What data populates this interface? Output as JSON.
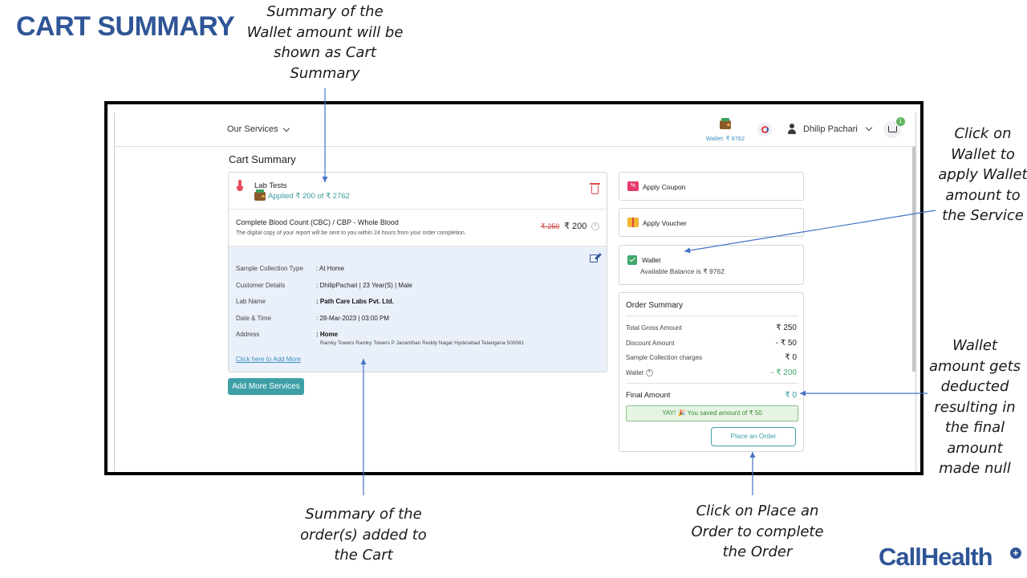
{
  "slide": {
    "title": "CART SUMMARY",
    "brand": "CallHealth",
    "brand_mark": "+"
  },
  "callouts": {
    "wallet_summary": "Summary of the\nWallet amount will be\nshown as Cart\nSummary",
    "click_wallet": "Click on\nWallet to\napply Wallet\namount to\nthe Service",
    "wallet_deducted": "Wallet\namount gets\ndeducted\nresulting in\nthe final\namount\nmade null",
    "order_summary": "Summary of the\norder(s) added to\nthe Cart",
    "place_order": "Click on Place an\nOrder to complete\nthe Order"
  },
  "nav": {
    "services": "Our Services",
    "wallet_label": "Wallet: ₹ 9762",
    "user_name": "Dhilip Pachari",
    "cart_count": "1"
  },
  "page": {
    "heading": "Cart Summary"
  },
  "lab": {
    "title": "Lab Tests",
    "applied": "Applied ₹ 200 of ₹ 2762",
    "test_name": "Complete Blood Count (CBC) /  CBP - Whole Blood",
    "test_note": "The digital copy of your report will be sent to you within 24 hours from your order completion.",
    "old_price": "₹ 250",
    "new_price": "₹ 200",
    "details": [
      {
        "label": "Sample Collection Type",
        "value": ": At Home"
      },
      {
        "label": "Customer Details",
        "value": ": DhilipPachari  |  23 Year(S)  |  Male"
      },
      {
        "label": "Lab Name",
        "value": ": Path Care Labs Pvt. Ltd."
      },
      {
        "label": "Date & Time",
        "value": ": 28-Mar-2023  |  03:00 PM"
      },
      {
        "label": "Address",
        "value": ": Home"
      }
    ],
    "address_line": "Ramky Towers Ramky Towers P Janardhan Reddy Nagar Hyderabad Telangana 500081",
    "add_more_link": "Click here to Add More",
    "add_services_button": "Add More Services"
  },
  "side": {
    "coupon": "Apply Coupon",
    "voucher": "Apply Voucher",
    "wallet_title": "Wallet",
    "wallet_balance": "Available Balance is ₹ 9762"
  },
  "order_summary": {
    "title": "Order Summary",
    "rows": [
      {
        "label": "Total Gross Amount",
        "value": "₹ 250"
      },
      {
        "label": "Discount Amount",
        "value": "- ₹ 50"
      },
      {
        "label": "Sample Collection charges",
        "value": "₹ 0"
      },
      {
        "label": "Wallet",
        "value": "- ₹ 200"
      }
    ],
    "final_label": "Final Amount",
    "final_value": "₹ 0",
    "saved_message": "YAY! 🎉  You saved amount of ₹ 50",
    "place_order_button": "Place an Order"
  },
  "colors": {
    "title_blue": "#2f5597",
    "teal": "#3ea0a6",
    "green": "#3fa76a",
    "arrow": "#4472c4"
  }
}
